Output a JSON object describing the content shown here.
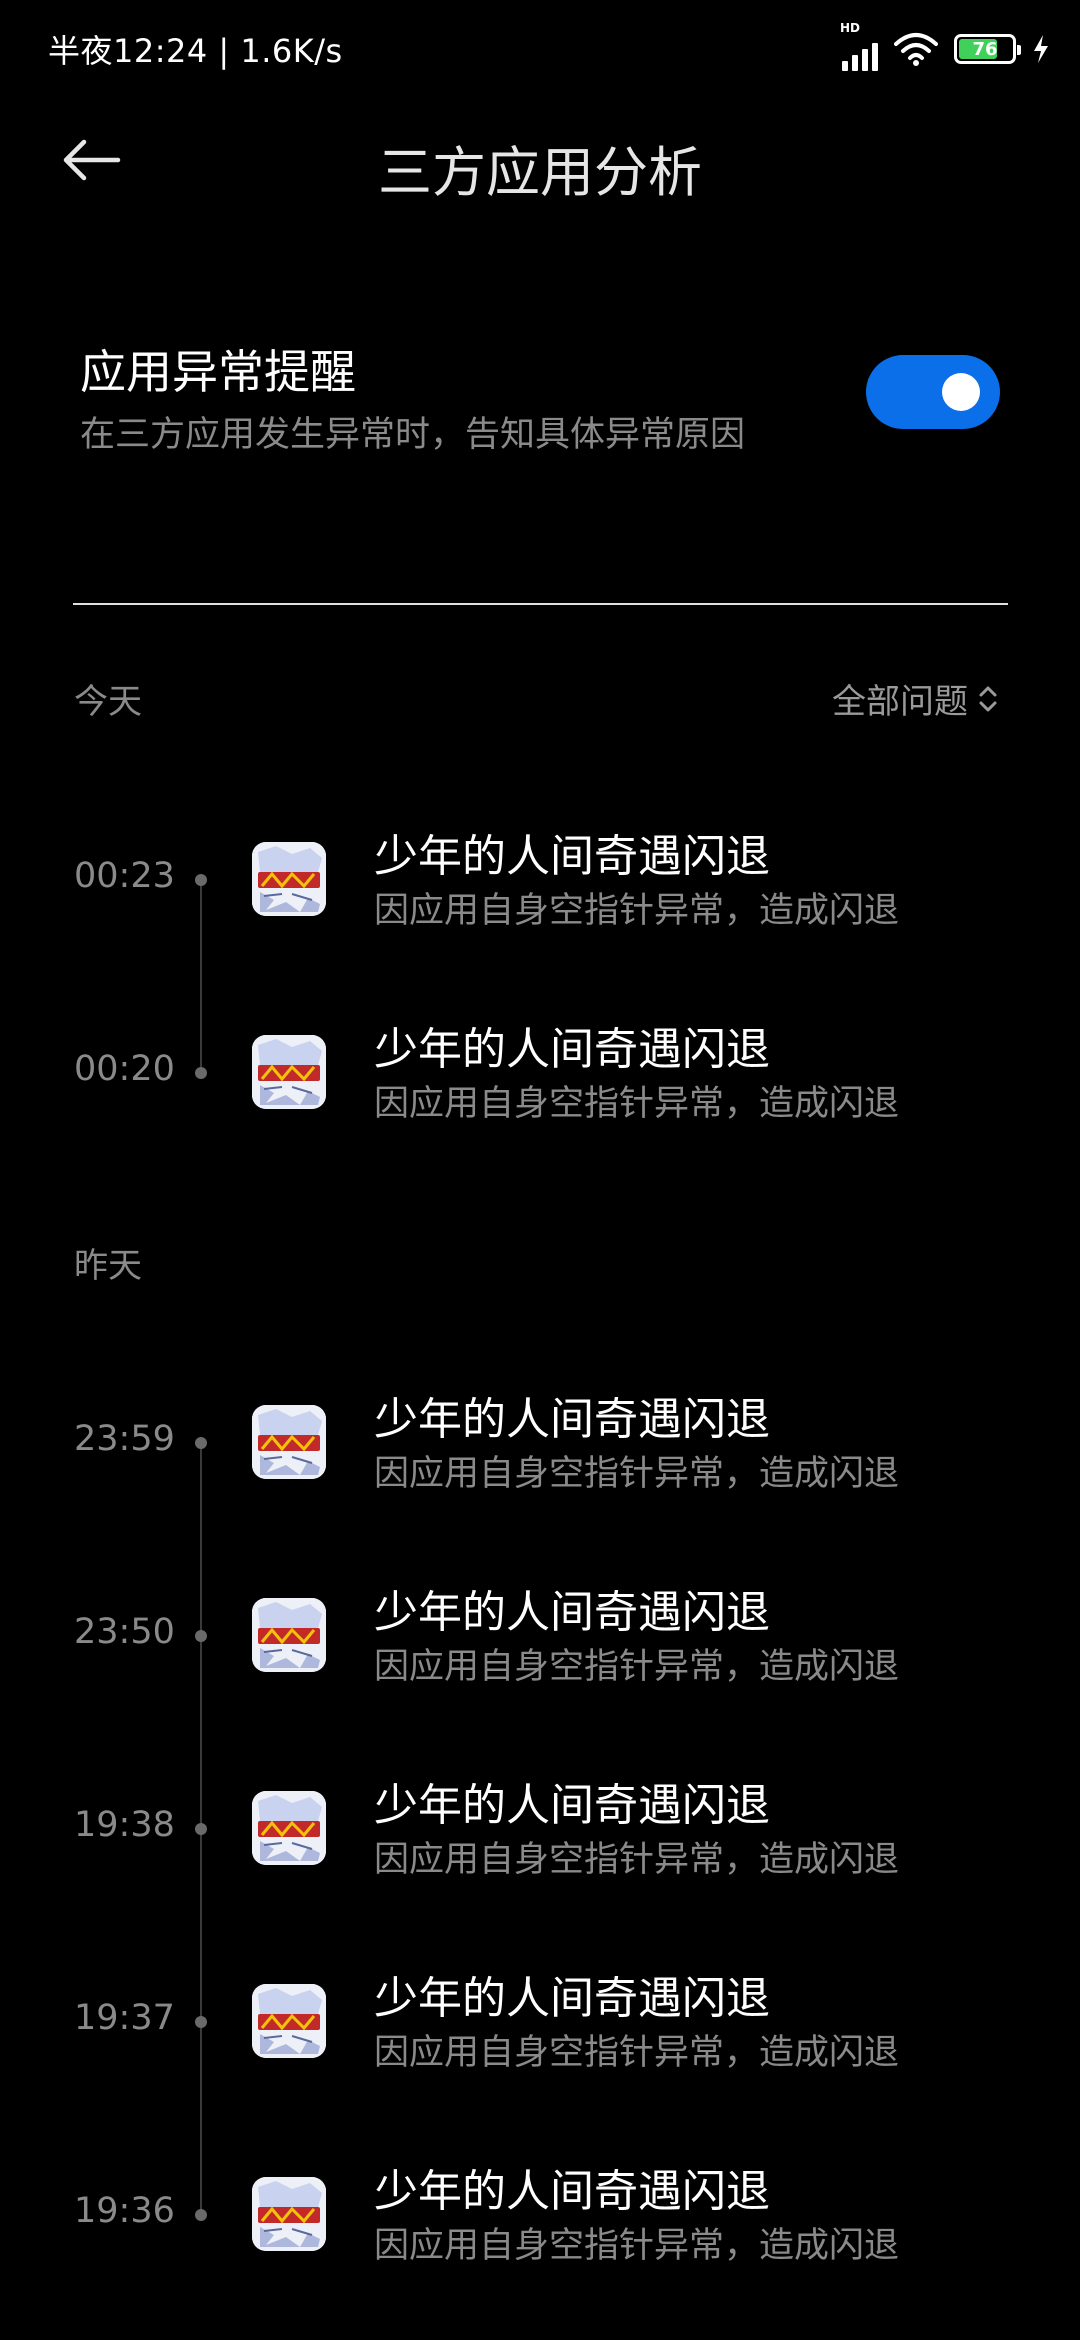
{
  "status_bar": {
    "time_text": "半夜12:24 | 1.6K/s",
    "network_badge": "HD",
    "battery_level": "76",
    "battery_fraction": 0.76,
    "icons": [
      "signal-icon",
      "wifi-icon",
      "battery-icon",
      "charging-icon"
    ]
  },
  "header": {
    "title": "三方应用分析",
    "back_icon": "back-arrow-icon"
  },
  "setting": {
    "title": "应用异常提醒",
    "description": "在三方应用发生异常时，告知具体异常原因",
    "enabled": true,
    "accent_color": "#0a6fe8"
  },
  "filter": {
    "label": "全部问题",
    "icon": "sort-updown-icon"
  },
  "sections": [
    {
      "label": "今天",
      "entries": [
        {
          "time": "00:23",
          "title": "少年的人间奇遇闪退",
          "desc": "因应用自身空指针异常，造成闪退"
        },
        {
          "time": "00:20",
          "title": "少年的人间奇遇闪退",
          "desc": "因应用自身空指针异常，造成闪退"
        }
      ]
    },
    {
      "label": "昨天",
      "entries": [
        {
          "time": "23:59",
          "title": "少年的人间奇遇闪退",
          "desc": "因应用自身空指针异常，造成闪退"
        },
        {
          "time": "23:50",
          "title": "少年的人间奇遇闪退",
          "desc": "因应用自身空指针异常，造成闪退"
        },
        {
          "time": "19:38",
          "title": "少年的人间奇遇闪退",
          "desc": "因应用自身空指针异常，造成闪退"
        },
        {
          "time": "19:37",
          "title": "少年的人间奇遇闪退",
          "desc": "因应用自身空指针异常，造成闪退"
        },
        {
          "time": "19:36",
          "title": "少年的人间奇遇闪退",
          "desc": "因应用自身空指针异常，造成闪退"
        }
      ]
    }
  ]
}
